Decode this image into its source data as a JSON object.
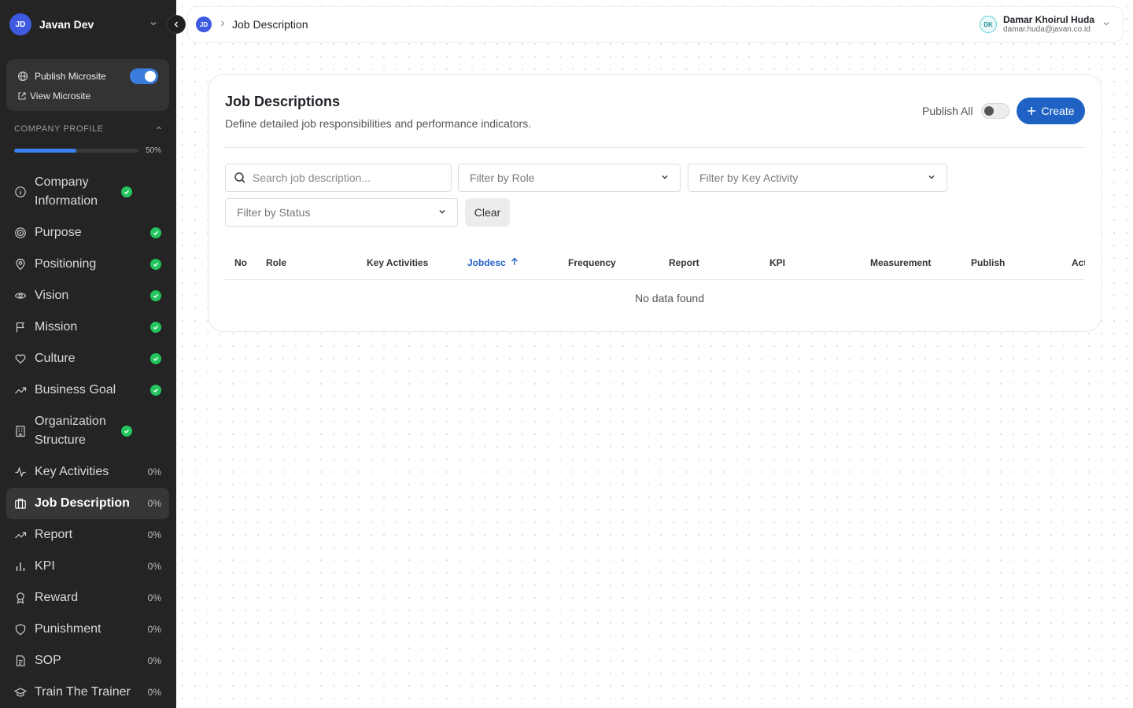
{
  "workspace": {
    "initials": "JD",
    "name": "Javan Dev"
  },
  "microsite": {
    "publish_label": "Publish Microsite",
    "published": true,
    "view_label": "View Microsite"
  },
  "company_profile": {
    "label": "COMPANY PROFILE",
    "progress": 0.5,
    "progress_text": "50%"
  },
  "nav": [
    {
      "label": "Company Information",
      "status": "done",
      "icon": "info-icon"
    },
    {
      "label": "Purpose",
      "status": "done",
      "icon": "target-icon"
    },
    {
      "label": "Positioning",
      "status": "done",
      "icon": "map-pin-icon"
    },
    {
      "label": "Vision",
      "status": "done",
      "icon": "eye-icon"
    },
    {
      "label": "Mission",
      "status": "done",
      "icon": "flag-icon"
    },
    {
      "label": "Culture",
      "status": "done",
      "icon": "heart-icon"
    },
    {
      "label": "Business Goal",
      "status": "done",
      "icon": "trending-up-icon"
    },
    {
      "label": "Organization Structure",
      "status": "done",
      "icon": "building-icon"
    },
    {
      "label": "Key Activities",
      "status": "0%",
      "icon": "activity-icon"
    },
    {
      "label": "Job Description",
      "status": "0%",
      "icon": "briefcase-icon",
      "active": true
    },
    {
      "label": "Report",
      "status": "0%",
      "icon": "trending-up-icon"
    },
    {
      "label": "KPI",
      "status": "0%",
      "icon": "bar-chart-icon"
    },
    {
      "label": "Reward",
      "status": "0%",
      "icon": "award-icon"
    },
    {
      "label": "Punishment",
      "status": "0%",
      "icon": "shield-icon"
    },
    {
      "label": "SOP",
      "status": "0%",
      "icon": "file-text-icon"
    },
    {
      "label": "Train The Trainer",
      "status": "0%",
      "icon": "graduation-cap-icon"
    }
  ],
  "topbar": {
    "breadcrumb_avatar": "JD",
    "breadcrumb": "Job Description",
    "user": {
      "initials": "DK",
      "name": "Damar Khoirul Huda",
      "email": "damar.huda@javan.co.id"
    }
  },
  "page": {
    "title": "Job Descriptions",
    "subtitle": "Define detailed job responsibilities and performance indicators.",
    "publish_all_label": "Publish All",
    "publish_all": false,
    "create_label": "Create"
  },
  "filters": {
    "search_placeholder": "Search job description...",
    "role": "Filter by Role",
    "key_activity": "Filter by Key Activity",
    "status": "Filter by Status",
    "clear_label": "Clear"
  },
  "table": {
    "columns": [
      "No",
      "Role",
      "Key Activities",
      "Jobdesc",
      "Frequency",
      "Report",
      "KPI",
      "Measurement",
      "Publish",
      "Actions"
    ],
    "sorted_column": "Jobdesc",
    "sort_direction": "asc",
    "empty_text": "No data found"
  },
  "colors": {
    "accent": "#1f62c4",
    "sidebar_bg": "#242424",
    "success": "#22c55e",
    "sorted": "#2463c5"
  }
}
